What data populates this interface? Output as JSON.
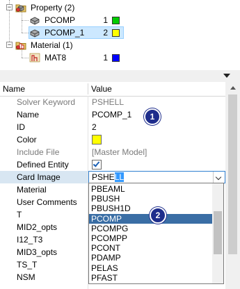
{
  "tree": {
    "property_group": {
      "label": "Property (2)",
      "expander": "−"
    },
    "properties": [
      {
        "label": "PCOMP",
        "id": "1",
        "color": "#00cc00"
      },
      {
        "label": "PCOMP_1",
        "id": "2",
        "color": "#ffff00"
      }
    ],
    "material_group": {
      "label": "Material (1)",
      "expander": "−"
    },
    "materials": [
      {
        "label": "MAT8",
        "id": "1",
        "color": "#0000ff"
      }
    ]
  },
  "grid": {
    "header": {
      "name": "Name",
      "value": "Value"
    },
    "rows": {
      "solver_keyword": {
        "name": "Solver Keyword",
        "value": "PSHELL"
      },
      "name": {
        "name": "Name",
        "value": "PCOMP_1"
      },
      "id": {
        "name": "ID",
        "value": "2"
      },
      "color": {
        "name": "Color",
        "value_color": "#ffff00"
      },
      "include_file": {
        "name": "Include File",
        "value": "[Master Model]"
      },
      "defined_entity": {
        "name": "Defined Entity",
        "checked": true
      },
      "card_image": {
        "name": "Card Image",
        "value_prefix": "PSHE",
        "value_selected": "LL"
      },
      "material": {
        "name": "Material"
      },
      "user_comments": {
        "name": "User Comments"
      },
      "t": {
        "name": "T"
      },
      "mid2_opts": {
        "name": "MID2_opts"
      },
      "i12_t3": {
        "name": "I12_T3"
      },
      "mid3_opts": {
        "name": "MID3_opts"
      },
      "ts_t": {
        "name": "TS_T"
      },
      "nsm": {
        "name": "NSM"
      }
    },
    "card_image_options": [
      "PBEAML",
      "PBUSH",
      "PBUSH1D",
      "PCOMP",
      "PCOMPG",
      "PCOMPP",
      "PCONT",
      "PDAMP",
      "PELAS",
      "PFAST"
    ],
    "highlighted_option": "PCOMP"
  },
  "callouts": {
    "one": "1",
    "two": "2"
  }
}
